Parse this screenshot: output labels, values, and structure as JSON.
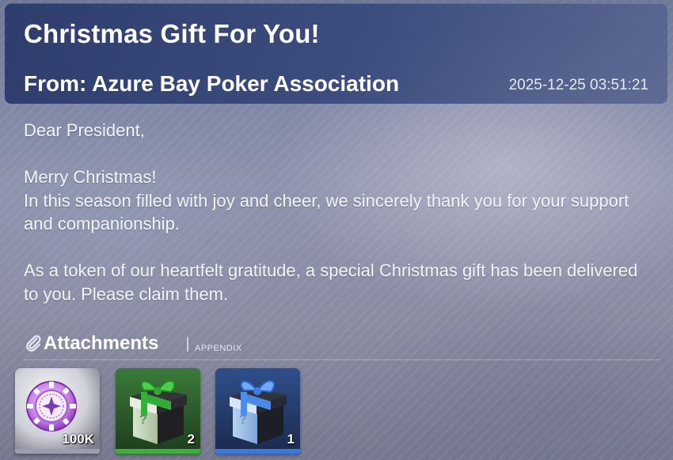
{
  "mail": {
    "title": "Christmas Gift For You!",
    "sender": "From: Azure Bay Poker Association",
    "timestamp": "2025-12-25 03:51:21",
    "body": {
      "greeting": "Dear President,",
      "line1": "Merry Christmas!",
      "line2": "In this season filled with joy and cheer, we sincerely thank you for your support and companionship.",
      "line3": "As a token of our heartfelt gratitude, a special Christmas gift has been delivered to you. Please claim them."
    }
  },
  "attachments": {
    "label": "Attachments",
    "sublabel": "APPENDIX",
    "icon": "paperclip-icon",
    "items": [
      {
        "icon": "poker-chip-icon",
        "quantity": "100K",
        "rarity_color": "#9aa0aa"
      },
      {
        "icon": "green-gift-box-icon",
        "quantity": "2",
        "rarity_color": "#3fae3a"
      },
      {
        "icon": "blue-gift-box-icon",
        "quantity": "1",
        "rarity_color": "#3a78e0"
      }
    ]
  },
  "colors": {
    "header_bg": "#283869",
    "text": "#ffffff"
  }
}
